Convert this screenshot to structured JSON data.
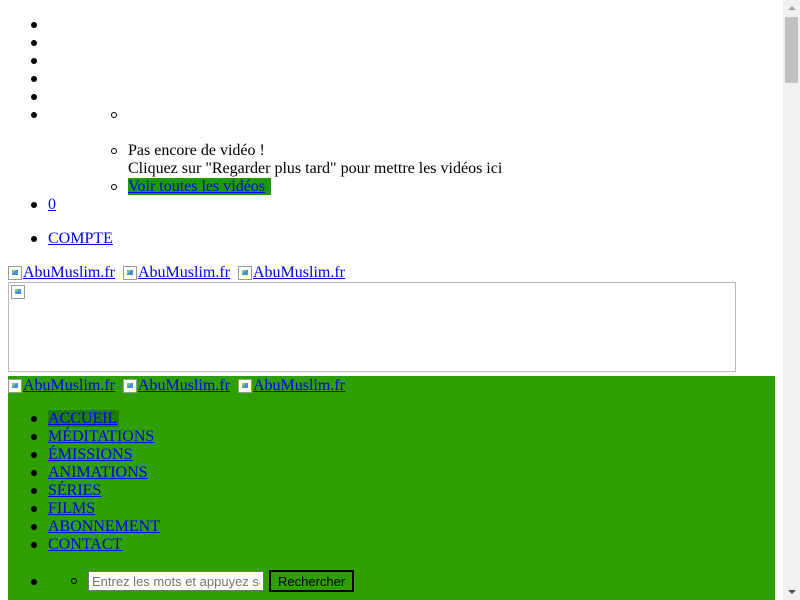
{
  "watch_later": {
    "empty_title": "Pas encore de vidéo !",
    "empty_hint": "Cliquez sur \"Regarder plus tard\" pour mettre les vidéos ici",
    "see_all": "Voir toutes les vidéos",
    "count": "0"
  },
  "account": {
    "label": "COMPTE"
  },
  "logo_alt": "AbuMuslim.fr",
  "nav": {
    "items": [
      {
        "label": "ACCUEIL",
        "active": true
      },
      {
        "label": "MÉDITATIONS"
      },
      {
        "label": "ÉMISSIONS"
      },
      {
        "label": "ANIMATIONS"
      },
      {
        "label": "SÉRIES"
      },
      {
        "label": "FILMS"
      },
      {
        "label": "ABONNEMENT"
      },
      {
        "label": "CONTACT"
      }
    ]
  },
  "search": {
    "placeholder": "Entrez les mots et appuyez sur Entrée",
    "button": "Rechercher"
  },
  "colors": {
    "header_green": "#2f9f00",
    "button_green": "#1b9a00",
    "link": "#0000ee"
  },
  "icons": {
    "broken_image": "broken-image-icon"
  }
}
